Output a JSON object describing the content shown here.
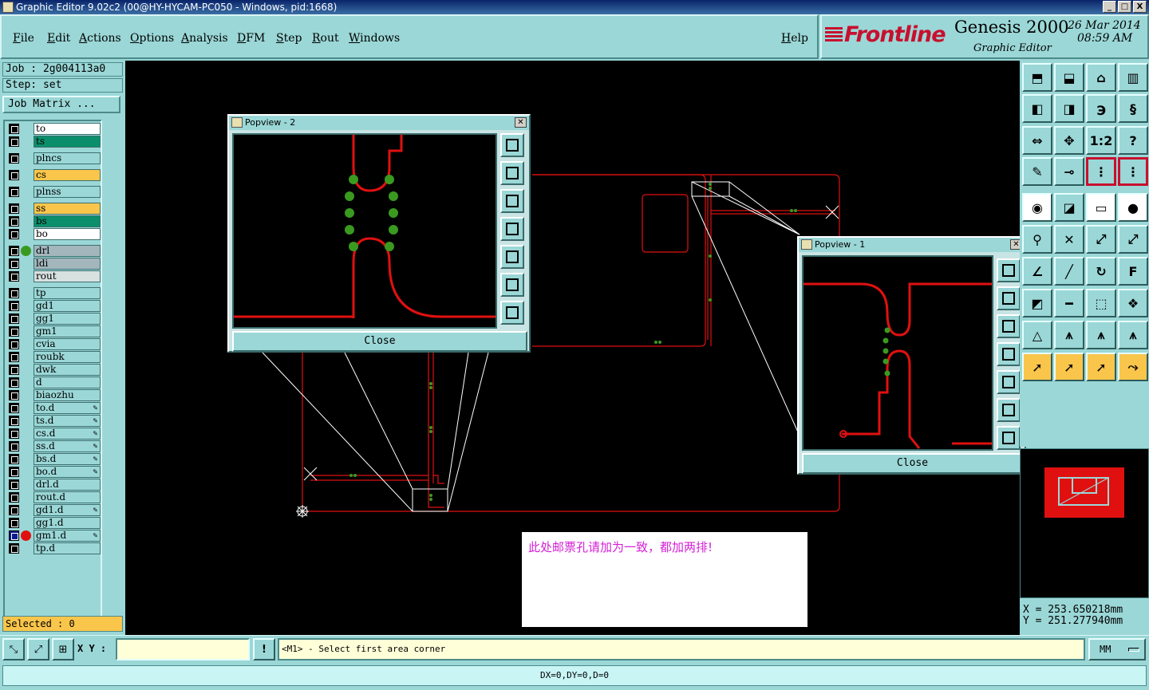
{
  "window": {
    "title": "Graphic Editor 9.02c2 (00@HY-HYCAM-PC050 - Windows, pid:1668)",
    "buttons": [
      "_",
      "□",
      "X"
    ]
  },
  "menu": {
    "items": [
      "File",
      "Edit",
      "Actions",
      "Options",
      "Analysis",
      "DFM",
      "Step",
      "Rout",
      "Windows"
    ],
    "help": "Help"
  },
  "brand": {
    "logo": "Frontline",
    "product": "Genesis 2000",
    "subtitle": "Graphic Editor",
    "date": "26 Mar 2014",
    "time": "08:59 AM"
  },
  "job": {
    "job_line": "Job : 2g004113a0",
    "step_line": "Step: set",
    "matrix_button": "Job Matrix ..."
  },
  "layers": [
    {
      "name": "to",
      "bg": "#ffffff",
      "dot": ""
    },
    {
      "name": "ts",
      "bg": "#0a8f6a",
      "dot": ""
    },
    {
      "name": "plncs",
      "bg": "#9bd7d7",
      "dot": ""
    },
    {
      "name": "cs",
      "bg": "#f9c54b",
      "dot": ""
    },
    {
      "name": "plnss",
      "bg": "#9bd7d7",
      "dot": ""
    },
    {
      "name": "ss",
      "bg": "#f9c54b",
      "dot": ""
    },
    {
      "name": "bs",
      "bg": "#0a8f6a",
      "dot": ""
    },
    {
      "name": "bo",
      "bg": "#ffffff",
      "dot": ""
    },
    {
      "name": "drl",
      "bg": "#a3b6bc",
      "dot": "#3a9a20"
    },
    {
      "name": "ldi",
      "bg": "#a3b6bc",
      "dot": ""
    },
    {
      "name": "rout",
      "bg": "#d8e0e0",
      "dot": ""
    },
    {
      "name": "tp",
      "bg": "#9bd7d7",
      "dot": ""
    },
    {
      "name": "gd1",
      "bg": "#9bd7d7",
      "dot": ""
    },
    {
      "name": "gg1",
      "bg": "#9bd7d7",
      "dot": ""
    },
    {
      "name": "gm1",
      "bg": "#9bd7d7",
      "dot": ""
    },
    {
      "name": "cvia",
      "bg": "#9bd7d7",
      "dot": ""
    },
    {
      "name": "roubk",
      "bg": "#9bd7d7",
      "dot": ""
    },
    {
      "name": "dwk",
      "bg": "#9bd7d7",
      "dot": ""
    },
    {
      "name": "d",
      "bg": "#9bd7d7",
      "dot": ""
    },
    {
      "name": "biaozhu",
      "bg": "#9bd7d7",
      "dot": ""
    },
    {
      "name": "to.d",
      "bg": "#9bd7d7",
      "dot": "",
      "edit": true
    },
    {
      "name": "ts.d",
      "bg": "#9bd7d7",
      "dot": "",
      "edit": true
    },
    {
      "name": "cs.d",
      "bg": "#9bd7d7",
      "dot": "",
      "edit": true
    },
    {
      "name": "ss.d",
      "bg": "#9bd7d7",
      "dot": "",
      "edit": true
    },
    {
      "name": "bs.d",
      "bg": "#9bd7d7",
      "dot": "",
      "edit": true
    },
    {
      "name": "bo.d",
      "bg": "#9bd7d7",
      "dot": "",
      "edit": true
    },
    {
      "name": "drl.d",
      "bg": "#9bd7d7",
      "dot": ""
    },
    {
      "name": "rout.d",
      "bg": "#9bd7d7",
      "dot": ""
    },
    {
      "name": "gd1.d",
      "bg": "#9bd7d7",
      "dot": "",
      "edit": true
    },
    {
      "name": "gg1.d",
      "bg": "#9bd7d7",
      "dot": ""
    },
    {
      "name": "gm1.d",
      "bg": "#9bd7d7",
      "dot": "#e01010",
      "edit": true,
      "active": true
    },
    {
      "name": "tp.d",
      "bg": "#9bd7d7",
      "dot": ""
    }
  ],
  "selected": "Selected : 0",
  "popview2": {
    "title": "Popview - 2",
    "close": "Close"
  },
  "popview1": {
    "title": "Popview - 1",
    "close": "Close"
  },
  "note": "此处邮票孔请加为一致，都加两排!",
  "coords": {
    "x": "X = 253.650218mm",
    "y": "Y = 251.277940mm"
  },
  "bottom": {
    "xy_label": "X Y :",
    "xy_value": "",
    "message": "<M1> - Select first area corner",
    "units": "MM",
    "status": "DX=0,DY=0,D=0"
  },
  "right_tools": [
    {
      "glyph": "⬒",
      "style": "normal"
    },
    {
      "glyph": "⬓",
      "style": "normal"
    },
    {
      "glyph": "⌂",
      "style": "normal"
    },
    {
      "glyph": "▥",
      "style": "normal"
    },
    {
      "glyph": "◧",
      "style": "normal"
    },
    {
      "glyph": "◨",
      "style": "normal"
    },
    {
      "glyph": "℈",
      "style": "normal"
    },
    {
      "glyph": "§",
      "style": "normal"
    },
    {
      "glyph": "⇔",
      "style": "normal"
    },
    {
      "glyph": "✥",
      "style": "normal"
    },
    {
      "glyph": "1:2",
      "style": "normal"
    },
    {
      "glyph": "?",
      "style": "normal"
    },
    {
      "glyph": "✎",
      "style": "normal"
    },
    {
      "glyph": "⊸",
      "style": "normal"
    },
    {
      "glyph": "⋮",
      "style": "active"
    },
    {
      "glyph": "⋮",
      "style": "active"
    },
    {
      "glyph": "◉",
      "style": "white"
    },
    {
      "glyph": "◪",
      "style": "normal"
    },
    {
      "glyph": "▭",
      "style": "white"
    },
    {
      "glyph": "●",
      "style": "white"
    },
    {
      "glyph": "⚲",
      "style": "normal"
    },
    {
      "glyph": "✕",
      "style": "normal"
    },
    {
      "glyph": "⤢",
      "style": "normal"
    },
    {
      "glyph": "⤢",
      "style": "normal"
    },
    {
      "glyph": "∠",
      "style": "normal"
    },
    {
      "glyph": "╱",
      "style": "normal"
    },
    {
      "glyph": "↻",
      "style": "normal"
    },
    {
      "glyph": "F",
      "style": "normal"
    },
    {
      "glyph": "◩",
      "style": "normal"
    },
    {
      "glyph": "━",
      "style": "normal"
    },
    {
      "glyph": "⬚",
      "style": "normal"
    },
    {
      "glyph": "❖",
      "style": "normal"
    },
    {
      "glyph": "△",
      "style": "normal"
    },
    {
      "glyph": "⩚",
      "style": "normal"
    },
    {
      "glyph": "⩚",
      "style": "normal"
    },
    {
      "glyph": "⩚",
      "style": "normal"
    },
    {
      "glyph": "➚",
      "style": "orange"
    },
    {
      "glyph": "➚",
      "style": "orange"
    },
    {
      "glyph": "➚",
      "style": "orange"
    },
    {
      "glyph": "⤳",
      "style": "orange"
    }
  ]
}
